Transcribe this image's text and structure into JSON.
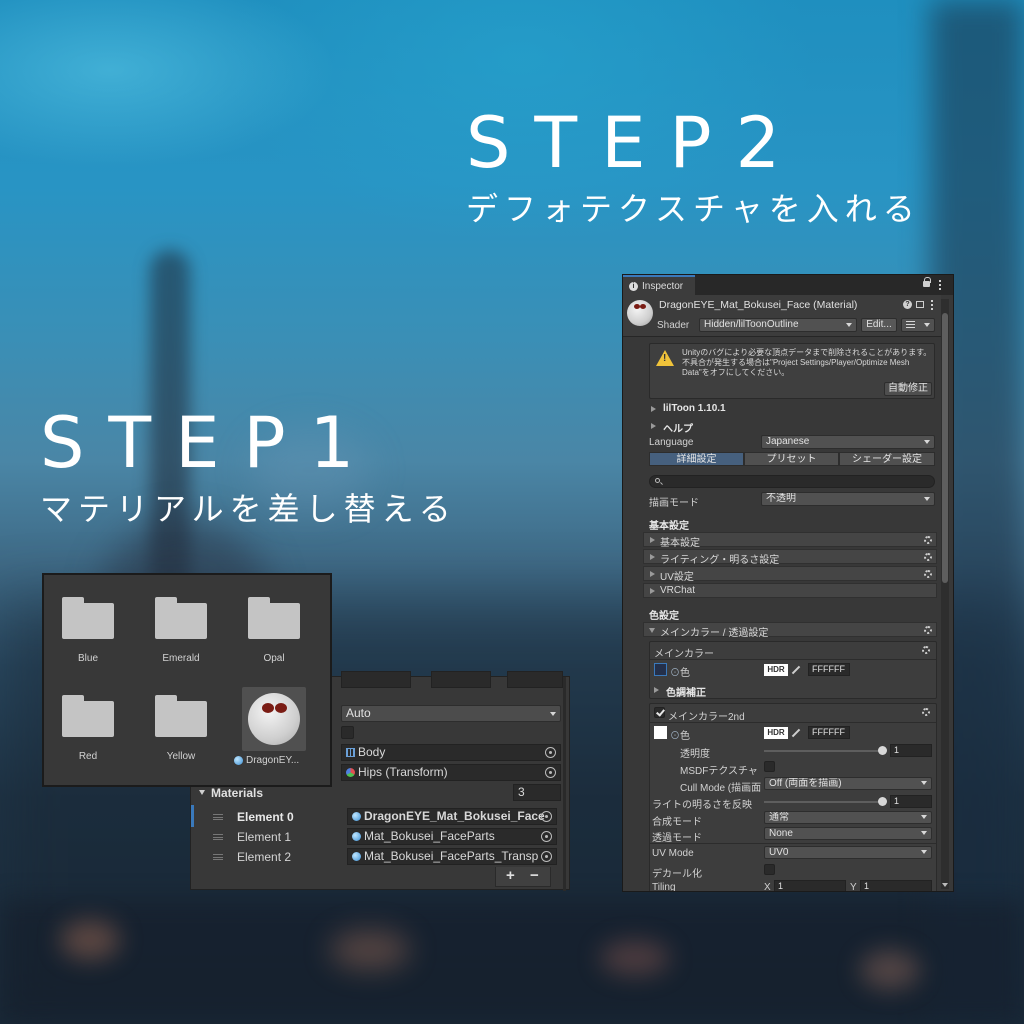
{
  "step2": {
    "title": "STEP2",
    "subtitle": "デフォテクスチャを入れる"
  },
  "step1": {
    "title": "STEP1",
    "subtitle": "マテリアルを差し替える"
  },
  "folders": {
    "items": [
      "Blue",
      "Emerald",
      "Opal",
      "Red",
      "Yellow"
    ],
    "material_label": "DragonEY..."
  },
  "mesh": {
    "auto_value": "Auto",
    "body_value": "Body",
    "hips_value": "Hips (Transform)",
    "materials_label": "Materials",
    "materials_count": "3",
    "elements": [
      {
        "label": "Element 0",
        "value": "DragonEYE_Mat_Bokusei_Face"
      },
      {
        "label": "Element 1",
        "value": "Mat_Bokusei_FaceParts"
      },
      {
        "label": "Element 2",
        "value": "Mat_Bokusei_FaceParts_Transp"
      }
    ],
    "plus_label": "+",
    "minus_label": "−"
  },
  "inspector": {
    "tab_label": "Inspector",
    "material_name": "DragonEYE_Mat_Bokusei_Face (Material)",
    "shader_label": "Shader",
    "shader_value": "Hidden/lilToonOutline",
    "edit_label": "Edit...",
    "warning_text": "Unityのバグにより必要な頂点データまで削除されることがあります。不具合が発生する場合は\"Project Settings/Player/Optimize Mesh Data\"をオフにしてください。",
    "auto_fix_label": "自動修正",
    "version_label": "lilToon 1.10.1",
    "help_label": "ヘルプ",
    "language_label": "Language",
    "language_value": "Japanese",
    "tabs": [
      "詳細設定",
      "プリセット",
      "シェーダー設定"
    ],
    "render_mode_label": "描画モード",
    "render_mode_value": "不透明",
    "basic_header": "基本設定",
    "sections": [
      "基本設定",
      "ライティング・明るさ設定",
      "UV設定",
      "VRChat"
    ],
    "color_header": "色設定",
    "main_color_section": "メインカラー / 透過設定",
    "main_color_group": "メインカラー",
    "color_label": "色",
    "hdr_label": "HDR",
    "hex_value": "FFFFFF",
    "tone_correction": "色調補正",
    "main_color_2nd": "メインカラー2nd",
    "color2_label": "色",
    "hex2_value": "FFFFFF",
    "opacity_label": "透明度",
    "opacity_value": "1",
    "msdf_label": "MSDFテクスチャ",
    "cull_label": "Cull Mode (描画面",
    "cull_value": "Off (両面を描画)",
    "light_label": "ライトの明るさを反映",
    "light_value": "1",
    "blend_label": "合成モード",
    "blend_value": "通常",
    "alpha_label": "透過モード",
    "alpha_value": "None",
    "uv_mode_label": "UV Mode",
    "uv_mode_value": "UV0",
    "decal_label": "デカール化",
    "tiling_label": "Tiling",
    "tiling_x_label": "X",
    "tiling_x_value": "1",
    "tiling_y_label": "Y",
    "tiling_y_value": "1"
  },
  "colors": {
    "accent_blue": "#3a79bb",
    "tab_selected": "#46607e",
    "warning_yellow": "#f0c33a",
    "swatch_navy": "#24304a"
  }
}
